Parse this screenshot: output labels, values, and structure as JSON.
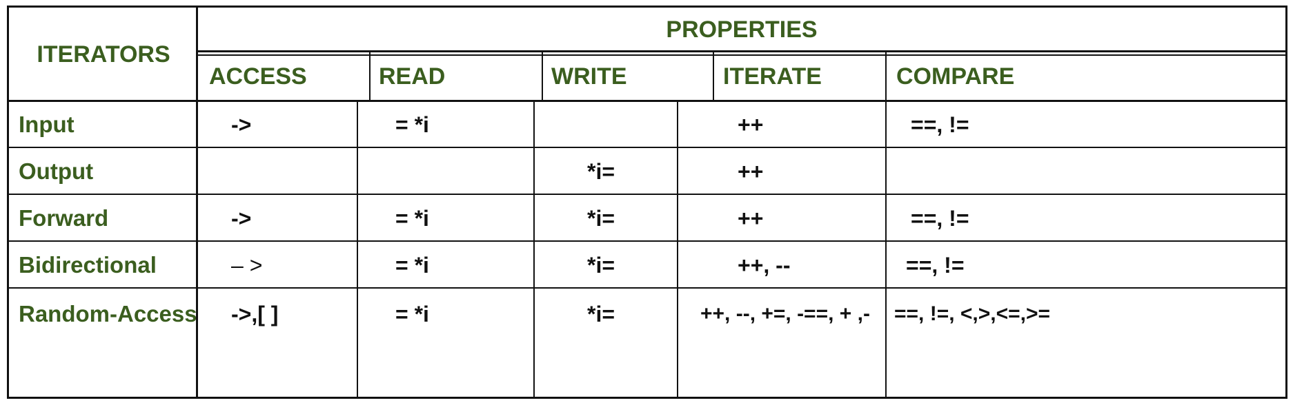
{
  "header": {
    "first_column": "ITERATORS",
    "group": "PROPERTIES",
    "columns": [
      "ACCESS",
      "READ",
      "WRITE",
      "ITERATE",
      "COMPARE"
    ]
  },
  "rows": [
    {
      "name": "Input",
      "access": "->",
      "read": "= *i",
      "write": "",
      "iterate": "++",
      "compare": "==, !="
    },
    {
      "name": "Output",
      "access": "",
      "read": "",
      "write": "*i=",
      "iterate": "++",
      "compare": ""
    },
    {
      "name": "Forward",
      "access": "->",
      "read": "= *i",
      "write": "*i=",
      "iterate": "++",
      "compare": "==, !="
    },
    {
      "name": "Bidirectional",
      "access": "– >",
      "read": "= *i",
      "write": "*i=",
      "iterate": "++, --",
      "compare": "==, !="
    },
    {
      "name": "Random-Access",
      "access": "->,[ ]",
      "read": "= *i",
      "write": "*i=",
      "iterate": "++, --, +=, -==, + ,-",
      "compare": "==, !=, <,>,<=,>="
    }
  ]
}
